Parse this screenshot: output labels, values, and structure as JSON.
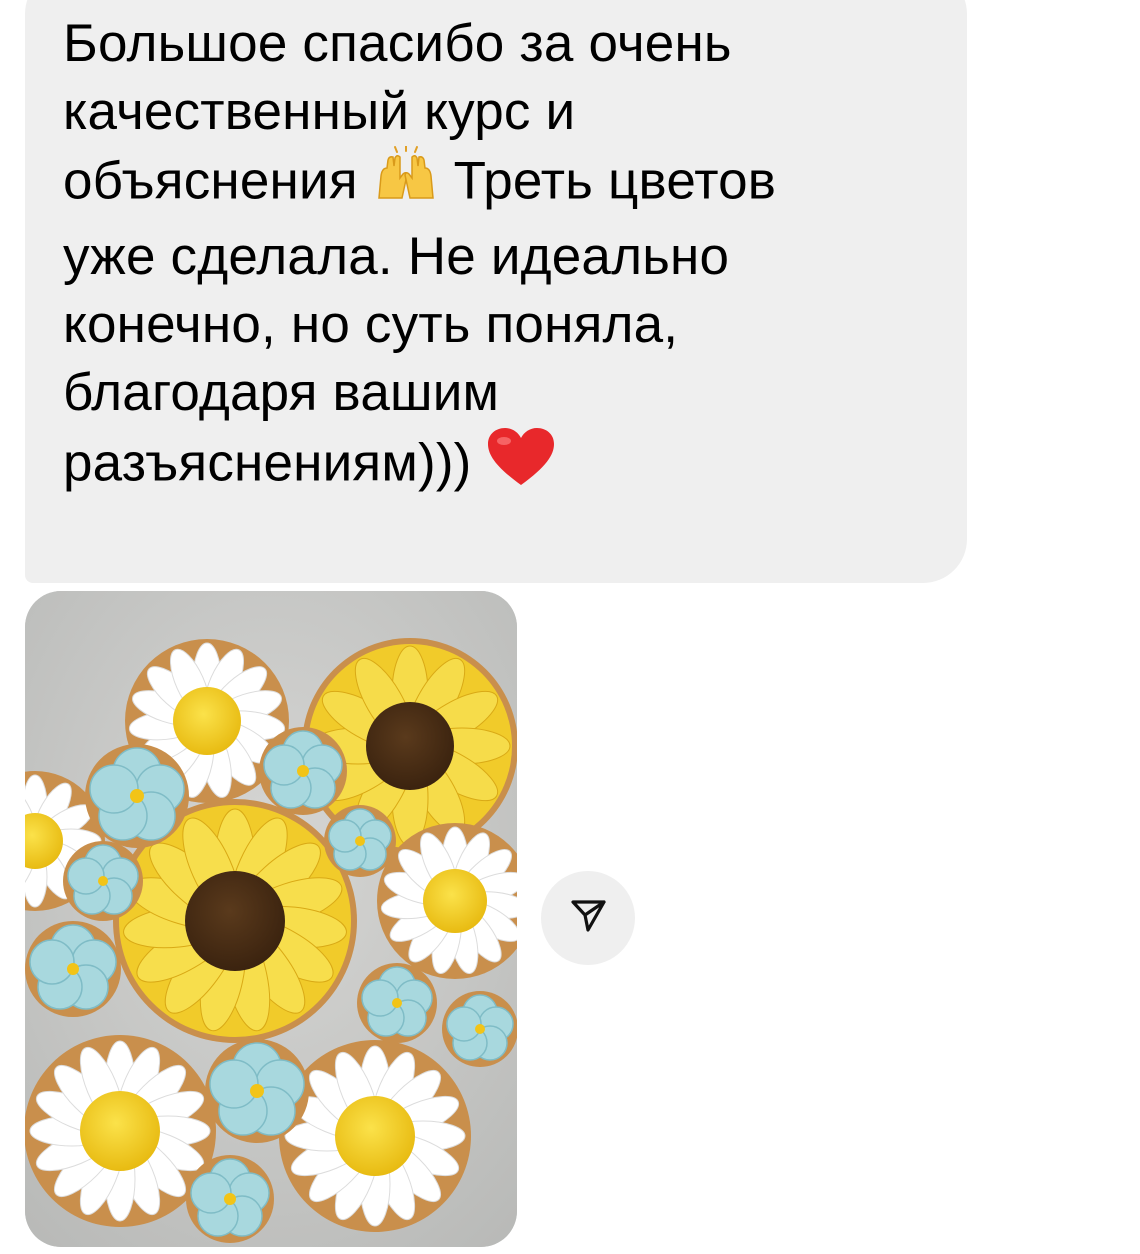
{
  "message": {
    "lines": [
      "Большое спасибо за очень",
      "качественный курс и",
      "объяснения",
      "Треть цветов",
      "уже сделала. Не идеально",
      "конечно, но суть поняла,",
      "благодаря вашим",
      "разъяснениям)))"
    ],
    "emoji_hands": "raising-hands-emoji",
    "emoji_heart": "red-heart-emoji"
  },
  "photo": {
    "subject": "gingerbread-flower-cookies-photo"
  },
  "share": {
    "icon": "paper-plane-icon"
  },
  "colors": {
    "bubble": "#efefef",
    "text": "#000000",
    "share_bg": "#efefef"
  }
}
